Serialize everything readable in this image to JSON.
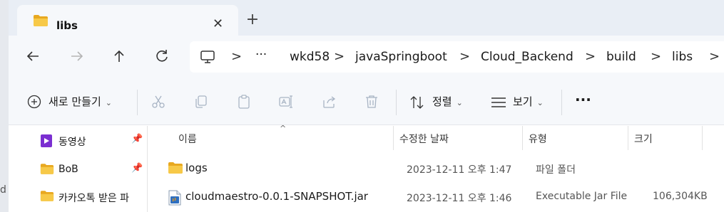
{
  "window": {
    "tab_title": "libs",
    "tab_close": "✕",
    "new_tab": "+"
  },
  "breadcrumb": {
    "overflow": "···",
    "items": [
      "wkd58",
      "javaSpringboot",
      "Cloud_Backend",
      "build",
      "libs"
    ],
    "separator": ">"
  },
  "toolbar": {
    "new_label": "새로 만들기",
    "sort_label": "정렬",
    "view_label": "보기",
    "more": "···"
  },
  "sidebar": {
    "items": [
      {
        "label": "동영상",
        "icon": "video-folder-icon",
        "pinned": true
      },
      {
        "label": "BoB",
        "icon": "folder-icon",
        "pinned": true
      },
      {
        "label": "카카오톡 받은 파",
        "icon": "folder-icon",
        "pinned": false
      }
    ]
  },
  "columns": {
    "name": "이름",
    "date": "수정한 날짜",
    "type": "유형",
    "size": "크기"
  },
  "files": [
    {
      "name": "logs",
      "date": "2023-12-11 오후 1:47",
      "type": "파일 폴더",
      "size": "",
      "icon": "folder-icon"
    },
    {
      "name": "cloudmaestro-0.0.1-SNAPSHOT.jar",
      "date": "2023-12-11 오후 1:46",
      "type": "Executable Jar File",
      "size": "106,304KB",
      "icon": "java-jar-icon"
    }
  ],
  "background": {
    "partial_text": "d"
  },
  "colors": {
    "tab_strip": "#e9eef5",
    "toolbar": "#f6f8fb",
    "folder": "#f2c244",
    "video_purple": "#7b2fd1"
  }
}
